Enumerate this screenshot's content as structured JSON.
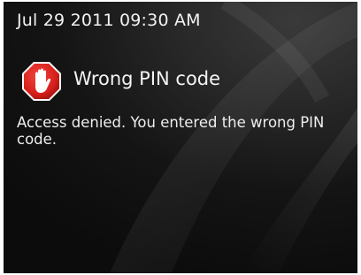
{
  "status_bar": {
    "datetime": "Jul 29 2011 09:30 AM"
  },
  "dialog": {
    "icon": "stop-hand-icon",
    "title": "Wrong PIN code",
    "message": "Access denied. You entered the wrong PIN code."
  },
  "colors": {
    "background": "#141414",
    "icon_red": "#d8201c",
    "text": "#f2f2f2"
  }
}
